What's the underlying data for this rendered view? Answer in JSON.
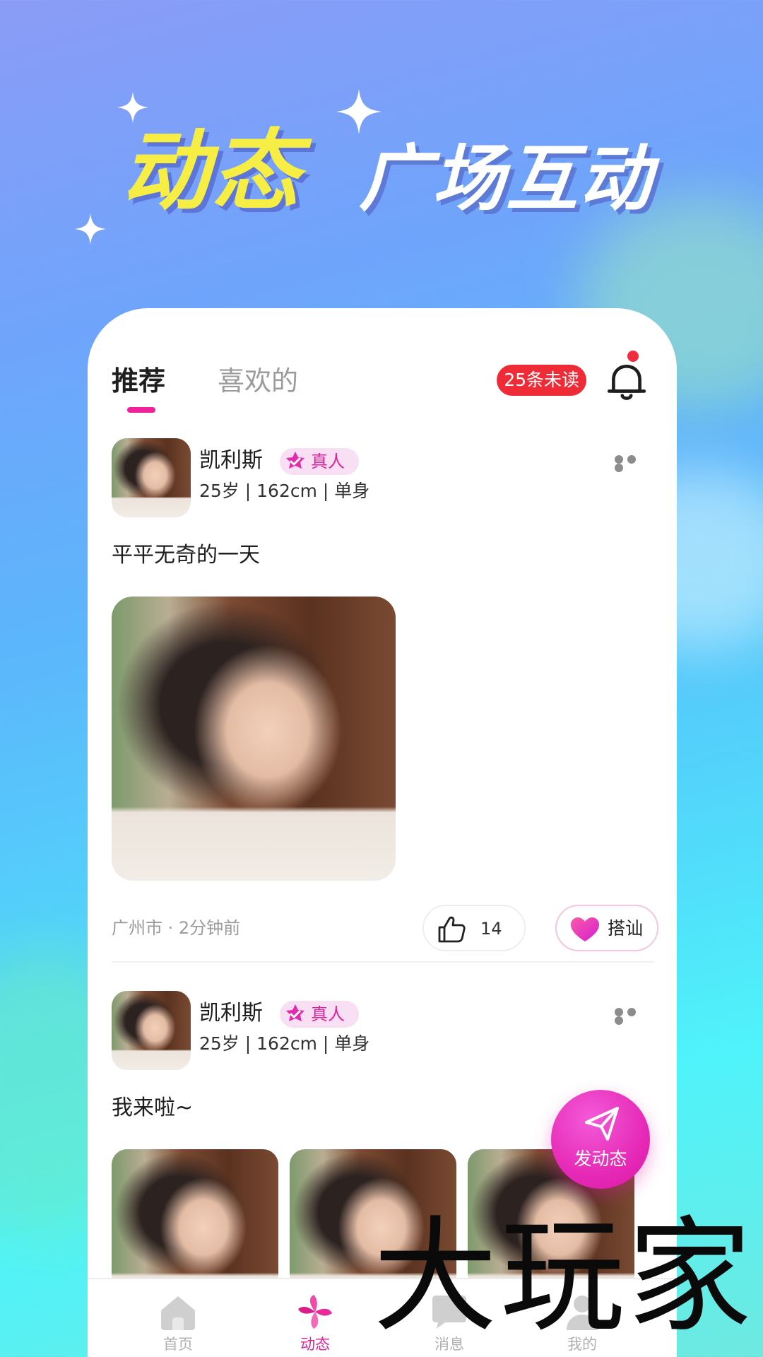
{
  "headline": {
    "part1": "动态",
    "part2": "广场互动"
  },
  "feed": {
    "tabs": [
      {
        "label": "推荐",
        "active": true
      },
      {
        "label": "喜欢的",
        "active": false
      }
    ],
    "unread_badge": "25条未读"
  },
  "posts": [
    {
      "username": "凯利斯",
      "badge": "真人",
      "info": "25岁 | 162cm | 单身",
      "text": "平平无奇的一天",
      "location_time": "广州市 · 2分钟前",
      "like_count": "14",
      "chat_label": "搭讪"
    },
    {
      "username": "凯利斯",
      "badge": "真人",
      "info": "25岁 | 162cm | 单身",
      "text": "我来啦~"
    }
  ],
  "fab": {
    "label": "发动态"
  },
  "tabbar": [
    {
      "label": "首页",
      "icon": "home-icon",
      "active": false
    },
    {
      "label": "动态",
      "icon": "pinwheel-icon",
      "active": true
    },
    {
      "label": "消息",
      "icon": "message-icon",
      "active": false
    },
    {
      "label": "我的",
      "icon": "person-icon",
      "active": false
    }
  ],
  "watermark": "大玩家",
  "colors": {
    "accent": "#e0239a",
    "badge_red": "#ef2b38",
    "headline_yellow": "#f6ee45"
  }
}
